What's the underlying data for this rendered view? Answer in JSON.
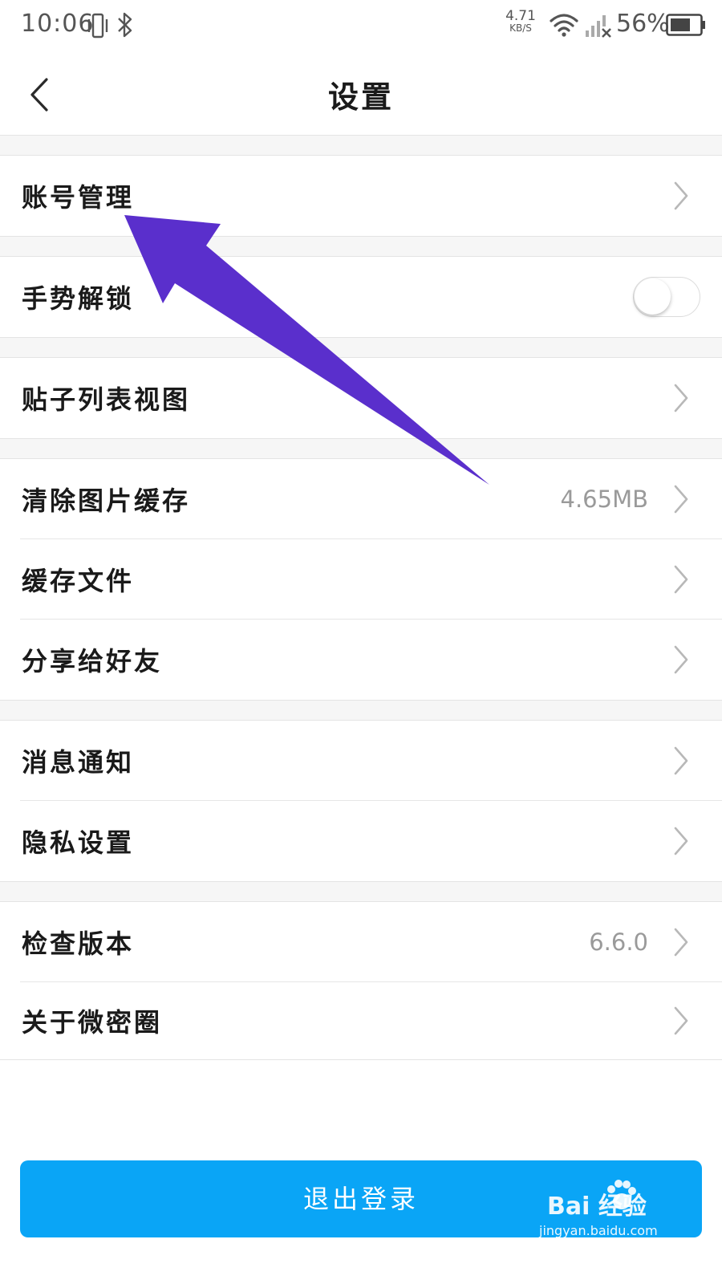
{
  "status_bar": {
    "time": "10:06",
    "net_speed_value": "4.71",
    "net_speed_unit": "KB/S",
    "battery": "56%"
  },
  "header": {
    "title": "设置"
  },
  "settings": {
    "account": {
      "label": "账号管理"
    },
    "gesture_lock": {
      "label": "手势解锁",
      "enabled": false
    },
    "post_list_view": {
      "label": "贴子列表视图"
    },
    "clear_image_cache": {
      "label": "清除图片缓存",
      "value": "4.65MB"
    },
    "cache_files": {
      "label": "缓存文件"
    },
    "share_friends": {
      "label": "分享给好友"
    },
    "notifications": {
      "label": "消息通知"
    },
    "privacy": {
      "label": "隐私设置"
    },
    "check_version": {
      "label": "检查版本",
      "value": "6.6.0"
    },
    "about": {
      "label": "关于微密圈"
    }
  },
  "logout": {
    "label": "退出登录"
  },
  "watermark": {
    "brand": "Bai 经验",
    "url": "jingyan.baidu.com"
  },
  "colors": {
    "accent": "#0aa5f6",
    "annotation_arrow": "#5a2fcc",
    "value_text": "#9a9a9a",
    "separator": "#f6f6f6"
  }
}
